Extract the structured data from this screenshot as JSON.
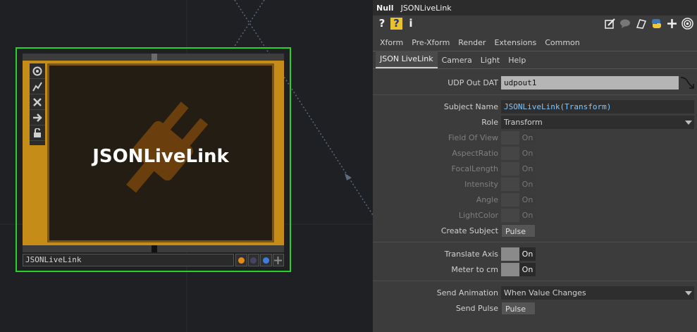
{
  "network": {
    "node": {
      "viewer_title": "JSONLiveLink",
      "name": "JSONLiveLink",
      "side_icons": [
        "viewer-icon",
        "bypass-icon",
        "close-icon",
        "arrow-right-icon",
        "lock-icon"
      ],
      "viewer_icon": "plug-icon",
      "flags": [
        {
          "icon": "cook-flag-icon",
          "color": "#e08a1c"
        },
        {
          "icon": "display-flag-icon",
          "color": "#444466"
        },
        {
          "icon": "render-flag-icon",
          "color": "#3a7fe0"
        },
        {
          "icon": "move-icon",
          "color": "#8a8a8a"
        }
      ],
      "highlight_color": "#27d327",
      "body_color": "#c58c17"
    }
  },
  "params": {
    "title": {
      "type": "Null",
      "name": "JSONLiveLink"
    },
    "toolbar_left": [
      "?",
      "?",
      "i"
    ],
    "toolbar_left_icons": [
      "help-icon",
      "python-help-icon",
      "info-icon"
    ],
    "toolbar_right_icons": [
      "edit-icon",
      "comment-icon",
      "clone-icon",
      "python-icon",
      "add-icon",
      "target-icon"
    ],
    "tabs_row1": [
      "Xform",
      "Pre-Xform",
      "Render",
      "Extensions",
      "Common"
    ],
    "tabs_row2": [
      "JSON LiveLink",
      "Camera",
      "Light",
      "Help"
    ],
    "active_tab": "JSON LiveLink",
    "udp_out_dat": {
      "label": "UDP Out DAT",
      "value": "udpout1"
    },
    "subject_name": {
      "label": "Subject Name",
      "value": "JSONLiveLink(Transform)"
    },
    "role": {
      "label": "Role",
      "value": "Transform"
    },
    "field_of_view": {
      "label": "Field Of View",
      "value": "On"
    },
    "aspect_ratio": {
      "label": "AspectRatio",
      "value": "On"
    },
    "focal_length": {
      "label": "FocalLength",
      "value": "On"
    },
    "intensity": {
      "label": "Intensity",
      "value": "On"
    },
    "angle": {
      "label": "Angle",
      "value": "On"
    },
    "light_color": {
      "label": "LightColor",
      "value": "On"
    },
    "create_subject": {
      "label": "Create Subject",
      "button": "Pulse"
    },
    "translate_axis": {
      "label": "Translate Axis",
      "value": "On"
    },
    "meter_to_cm": {
      "label": "Meter to cm",
      "value": "On"
    },
    "send_animation": {
      "label": "Send Animation",
      "value": "When Value Changes"
    },
    "send_pulse": {
      "label": "Send Pulse",
      "button": "Pulse"
    }
  }
}
